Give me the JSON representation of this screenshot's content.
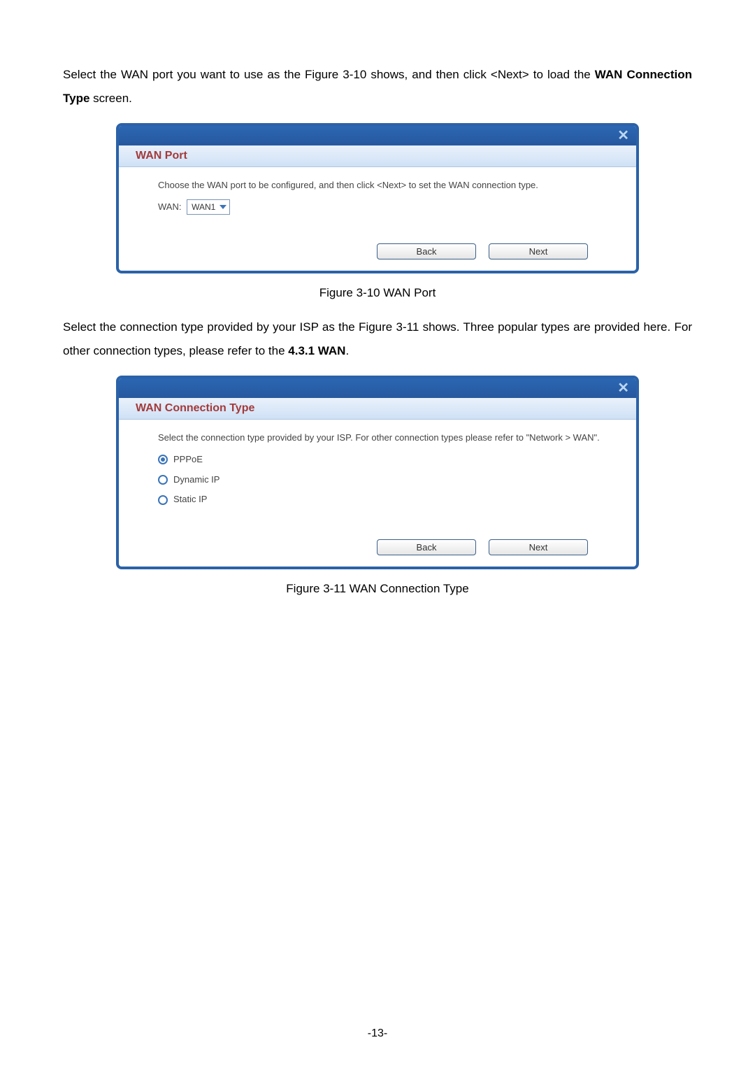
{
  "intro1": {
    "pre": "Select the WAN port you want to use as the Figure 3-10 shows, and then click <Next> to load the ",
    "bold": "WAN Connection Type",
    "post": " screen."
  },
  "panel1": {
    "close": "✕",
    "title": "WAN Port",
    "desc": "Choose the WAN port to be configured, and then click <Next> to set the WAN connection type.",
    "wan_label": "WAN:",
    "wan_select": {
      "value": "WAN1"
    },
    "back": "Back",
    "next": "Next"
  },
  "caption1": "Figure 3-10 WAN Port",
  "intro2": {
    "pre": "Select the connection type provided by your ISP as the Figure 3-11 shows. Three popular types are provided here. For other connection types, please refer to the ",
    "bold": "4.3.1 WAN",
    "post": "."
  },
  "panel2": {
    "close": "✕",
    "title": "WAN Connection Type",
    "desc": "Select the connection type provided by your ISP. For other connection types please refer to \"Network > WAN\".",
    "options": [
      {
        "label": "PPPoE",
        "checked": true
      },
      {
        "label": "Dynamic IP",
        "checked": false
      },
      {
        "label": "Static IP",
        "checked": false
      }
    ],
    "back": "Back",
    "next": "Next"
  },
  "caption2": "Figure 3-11 WAN Connection Type",
  "page_number": "-13-"
}
